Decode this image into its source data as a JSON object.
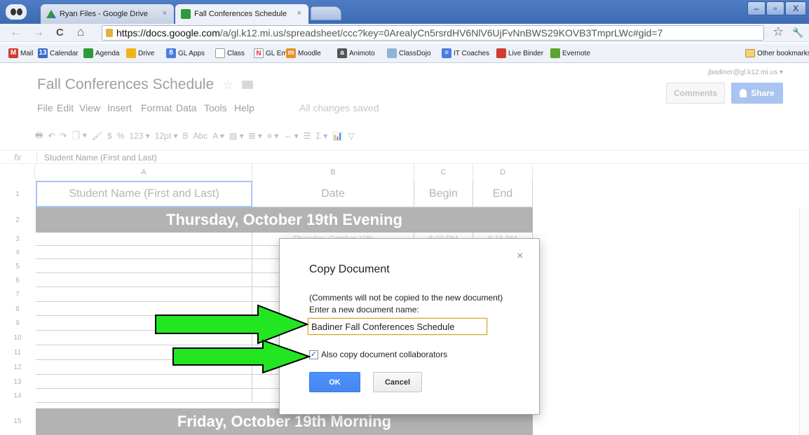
{
  "browser": {
    "tabs": [
      {
        "title": "Ryan Files - Google Drive",
        "close": "×"
      },
      {
        "title": "Fall Conferences Schedule",
        "close": "×"
      }
    ],
    "window_controls": {
      "minimize": "–",
      "maximize": "▫",
      "close": "X"
    },
    "nav": {
      "back": "←",
      "forward": "→",
      "reload": "C",
      "home": "⌂",
      "star": "☆",
      "wrench": "🔧"
    },
    "url_host": "https://docs.google.com",
    "url_rest": "/a/gl.k12.mi.us/spreadsheet/ccc?key=0ArealyCn5rsrdHV6NlV6UjFvNnBWS29KOVB3TmprLWc#gid=7",
    "bookmarks": [
      {
        "label": "Mail",
        "icon": "mail-icon",
        "color": "#d23c2f",
        "glyph": "M"
      },
      {
        "label": "Calendar",
        "icon": "calendar-icon",
        "color": "#3a6cc8",
        "glyph": "13"
      },
      {
        "label": "Agenda",
        "icon": "agenda-icon",
        "color": "#2c9b3a",
        "glyph": ""
      },
      {
        "label": "Drive",
        "icon": "drive-icon",
        "color": "#f2b21a",
        "glyph": ""
      },
      {
        "label": "GL Apps",
        "icon": "gl-apps-icon",
        "color": "#4a7be0",
        "glyph": "8"
      },
      {
        "label": "Class",
        "icon": "page-icon",
        "color": "#ffffff",
        "glyph": ""
      },
      {
        "label": "GL Email",
        "icon": "gl-email-icon",
        "color": "#ffffff",
        "glyph": "N"
      },
      {
        "label": "Moodle",
        "icon": "moodle-icon",
        "color": "#e8902a",
        "glyph": "m"
      },
      {
        "label": "Animoto",
        "icon": "animoto-icon",
        "color": "#555555",
        "glyph": "a"
      },
      {
        "label": "ClassDojo",
        "icon": "classdojo-icon",
        "color": "#8fb4d8",
        "glyph": ""
      },
      {
        "label": "IT Coaches",
        "icon": "it-coaches-icon",
        "color": "#4a7be0",
        "glyph": "≡"
      },
      {
        "label": "Live Binder",
        "icon": "live-binder-icon",
        "color": "#d23c2f",
        "glyph": ""
      },
      {
        "label": "Evernote",
        "icon": "evernote-icon",
        "color": "#5aa532",
        "glyph": ""
      }
    ],
    "other_bookmarks": "Other bookmarks"
  },
  "doc": {
    "title": "Fall Conferences Schedule",
    "menus": [
      "File",
      "Edit",
      "View",
      "Insert",
      "Format",
      "Data",
      "Tools",
      "Help"
    ],
    "save_status": "All changes saved",
    "account": "jbadiner@gl.k12.mi.us ▾",
    "comments_label": "Comments",
    "share_label": "Share",
    "format_bar": [
      "🖶",
      "↶",
      "↷",
      "🗍 ▾",
      "🖌",
      "$",
      "%",
      "123 ▾",
      "12pt ▾",
      "B",
      "Abc",
      "A ▾",
      "▨ ▾",
      "⊞ ▾",
      "≡ ▾",
      "⇔ ▾",
      "☰",
      "Σ ▾",
      "📊",
      "▽"
    ]
  },
  "formula": {
    "fx": "fx",
    "content": "Student Name (First and Last)"
  },
  "grid": {
    "columns": [
      "A",
      "B",
      "C",
      "D"
    ],
    "header_row": [
      "Student Name (First and Last)",
      "Date",
      "Begin",
      "End"
    ],
    "row_numbers": [
      "1",
      "2",
      "3",
      "4",
      "5",
      "6",
      "7",
      "8",
      "9",
      "10",
      "11",
      "12",
      "13",
      "14",
      "15"
    ],
    "banner_top": "Thursday, October 19th Evening",
    "banner_bottom": "Friday, October 19th Morning",
    "row3": {
      "date": "Thursday, October 19th",
      "begin": "5:00 PM",
      "end": "5:15 PM"
    }
  },
  "dialog": {
    "title": "Copy Document",
    "close": "×",
    "note": "(Comments will not be copied to the new document)",
    "prompt": "Enter a new document name:",
    "name_value": "Badiner Fall Conferences Schedule",
    "checkbox_checked": true,
    "checkbox_mark": "✓",
    "checkbox_label": "Also copy document collaborators",
    "ok_label": "OK",
    "cancel_label": "Cancel"
  },
  "colors": {
    "arrow_fill": "#22e622",
    "arrow_stroke": "#000000",
    "ok_blue": "#4d90fe",
    "banner_gray": "#b3b3b3"
  }
}
